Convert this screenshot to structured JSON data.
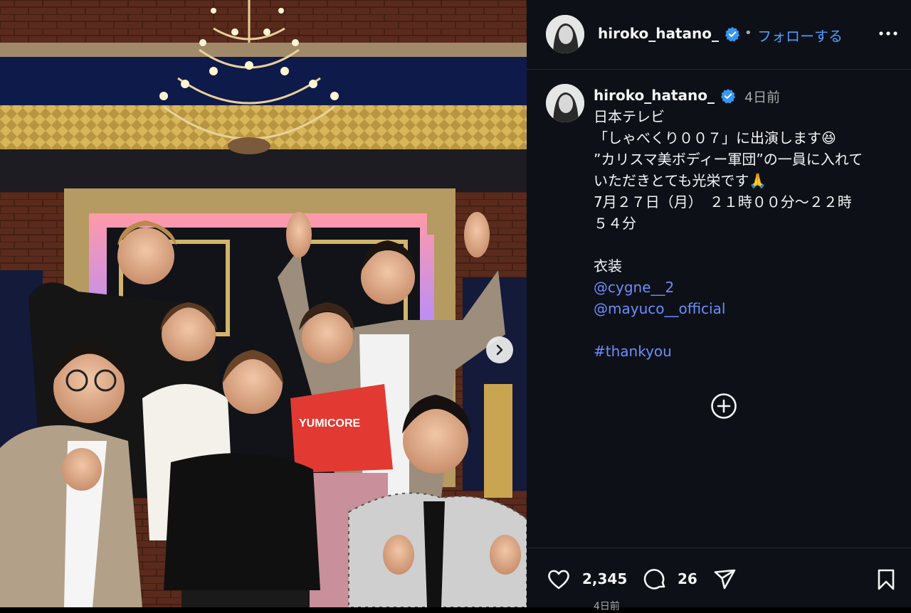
{
  "post": {
    "username": "hiroko_hatano_",
    "separator": "•",
    "follow_label": "フォローする",
    "time_ago": "4日前",
    "date_stub": "4日前"
  },
  "caption": {
    "lines": [
      "日本テレビ",
      "「しゃべくり００７」に出演します😆",
      "”カリスマ美ボディー軍団”の一員に入れて",
      "いただきとても光栄です🙏",
      "7月２７日（月）　２１時００分〜２２時",
      "５４分",
      "",
      "衣装"
    ],
    "mentions": [
      "@cygne__2",
      "@mayuco__official"
    ],
    "hashtag": "#thankyou"
  },
  "stats": {
    "likes": "2,345",
    "comments": "26"
  },
  "photo": {
    "shirt_text": "YUMICORE"
  },
  "icons": {
    "verified": "verified-badge-icon",
    "more": "more-options-icon",
    "next": "chevron-right-icon",
    "add_comment": "add-circle-icon",
    "like": "heart-icon",
    "comment": "comment-bubble-icon",
    "share": "paper-plane-icon",
    "save": "bookmark-icon"
  },
  "colors": {
    "panel_bg": "#0d1117",
    "link": "#4d9cff",
    "mention": "#6f8cff",
    "verified": "#3897f0"
  }
}
